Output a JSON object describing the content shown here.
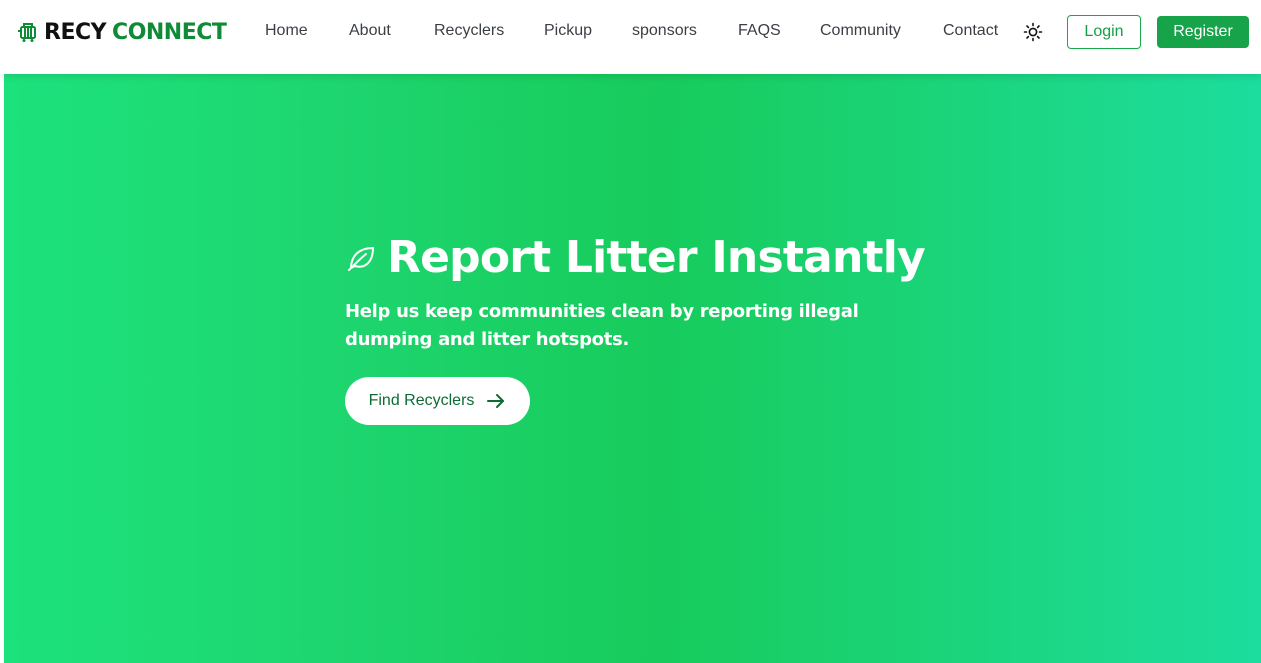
{
  "brand": {
    "name_part1": "RECY",
    "name_part2": "CONNECT",
    "icon": "recycle-cart-icon",
    "accent_color": "#0f8a36"
  },
  "nav": {
    "items": [
      {
        "label": "Home"
      },
      {
        "label": "About"
      },
      {
        "label": "Recyclers"
      },
      {
        "label": "Pickup"
      },
      {
        "label": "sponsors"
      },
      {
        "label": "FAQS"
      },
      {
        "label": "Community"
      },
      {
        "label": "Contact"
      }
    ],
    "theme_icon": "sun-icon",
    "login_label": "Login",
    "register_label": "Register"
  },
  "hero": {
    "icon": "leaf-icon",
    "title": "Report Litter Instantly",
    "subtitle": "Help us keep communities clean by reporting illegal dumping and litter hotspots.",
    "cta_label": "Find Recyclers",
    "cta_icon": "arrow-right-icon"
  },
  "colors": {
    "primary_green": "#16a34a",
    "hero_gradient_start": "#1ce27c",
    "hero_gradient_end": "#1cdd9e"
  }
}
